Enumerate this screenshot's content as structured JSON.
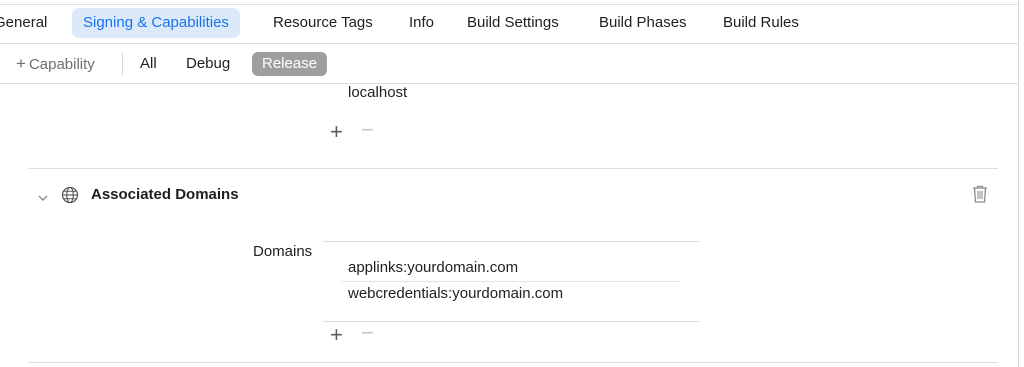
{
  "tabs": [
    {
      "label": "General",
      "active": false
    },
    {
      "label": "Signing & Capabilities",
      "active": true
    },
    {
      "label": "Resource Tags",
      "active": false
    },
    {
      "label": "Info",
      "active": false
    },
    {
      "label": "Build Settings",
      "active": false
    },
    {
      "label": "Build Phases",
      "active": false
    },
    {
      "label": "Build Rules",
      "active": false
    }
  ],
  "filterbar": {
    "add_capability_label": "Capability",
    "filters": [
      "All",
      "Debug",
      "Release"
    ],
    "selected_filter": "Release"
  },
  "previous_section": {
    "last_entry": "localhost"
  },
  "associated_domains": {
    "title": "Associated Domains",
    "domains_label": "Domains",
    "domains": [
      "applinks:yourdomain.com",
      "webcredentials:yourdomain.com"
    ]
  },
  "controls": {
    "plus_glyph": "+",
    "minus_glyph": "−"
  },
  "icons": {
    "add": "plus-icon",
    "remove": "minus-icon",
    "disclosure": "chevron-down-icon",
    "capability": "globe-icon",
    "delete": "trash-icon"
  },
  "colors": {
    "accent": "#1a73e8",
    "active_tab_bg": "#dbe9fb",
    "selected_filter_bg": "#9e9e9e"
  }
}
